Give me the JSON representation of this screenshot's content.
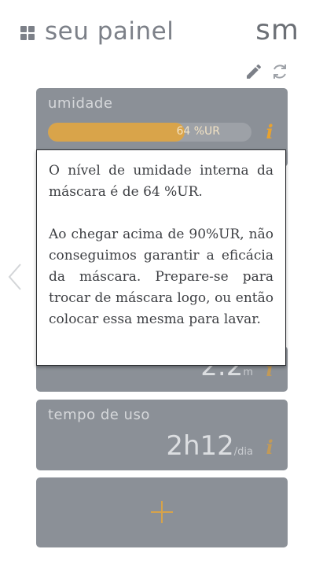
{
  "header": {
    "app_title": "seu painel",
    "user_initials": "sm",
    "icons": [
      "dashboard-icon",
      "edit-icon",
      "refresh-icon"
    ]
  },
  "cards": {
    "humidity": {
      "label": "umidade",
      "progress_percent": 64,
      "progress_text": "64 %UR",
      "info_symbol": "i"
    },
    "second": {
      "value": "2.2",
      "unit": "m",
      "info_symbol": "i"
    },
    "usage": {
      "label": "tempo de uso",
      "value": "2h12",
      "unit": "/dia",
      "info_symbol": "i"
    },
    "add": {
      "icon": "plus-icon"
    }
  },
  "tooltip": {
    "paragraph1": "O nível de umidade interna da máscara é de 64 %UR.",
    "paragraph2": "Ao chegar acima de 90%UR, não conseguimos garantir a eficácia da máscara. Prepare-se para trocar de máscara logo, ou então colocar essa mesma para lavar."
  },
  "colors": {
    "card_bg": "#8b9097",
    "accent": "#d9a44a",
    "info": "#e8a22f",
    "text_dark": "#3d3f43"
  }
}
